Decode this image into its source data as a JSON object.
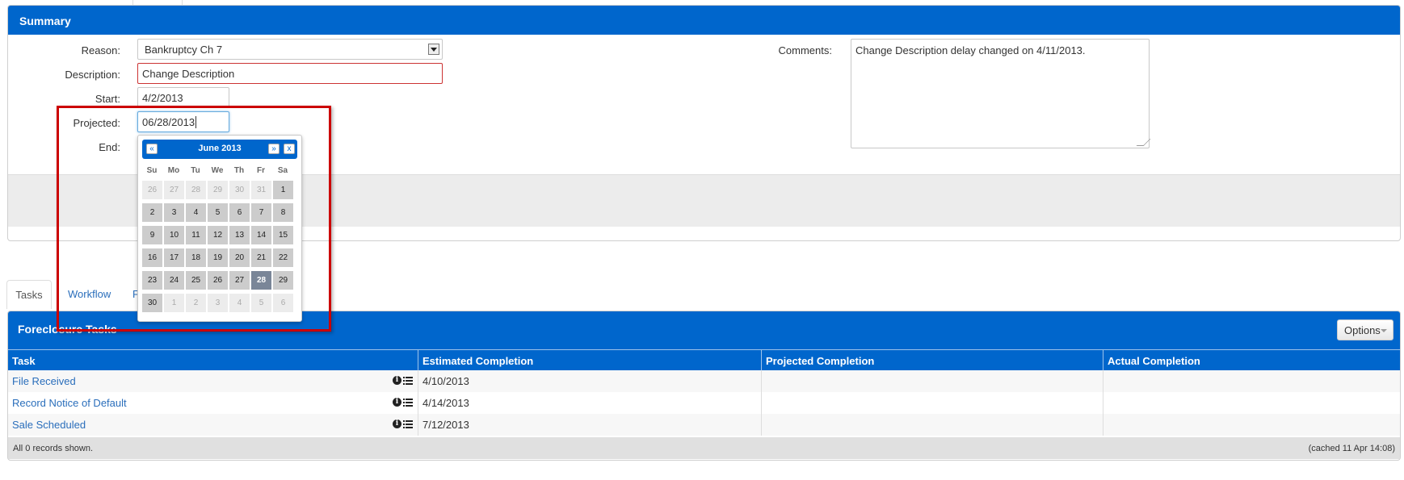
{
  "summary": {
    "title": "Summary",
    "reason_label": "Reason:",
    "reason_value": "Bankruptcy Ch 7",
    "description_label": "Description:",
    "description_value": "Change Description",
    "start_label": "Start:",
    "start_value": "4/2/2013",
    "projected_label": "Projected:",
    "projected_value": "06/28/2013",
    "end_label": "End:",
    "comments_label": "Comments:",
    "comments_value": "Change Description delay changed on 4/11/2013."
  },
  "datepicker": {
    "title": "June 2013",
    "prev": "«",
    "next": "»",
    "close": "x",
    "weekdays": [
      "Su",
      "Mo",
      "Tu",
      "We",
      "Th",
      "Fr",
      "Sa"
    ],
    "weeks": [
      [
        "26",
        "27",
        "28",
        "29",
        "30",
        "31",
        "1"
      ],
      [
        "2",
        "3",
        "4",
        "5",
        "6",
        "7",
        "8"
      ],
      [
        "9",
        "10",
        "11",
        "12",
        "13",
        "14",
        "15"
      ],
      [
        "16",
        "17",
        "18",
        "19",
        "20",
        "21",
        "22"
      ],
      [
        "23",
        "24",
        "25",
        "26",
        "27",
        "28",
        "29"
      ],
      [
        "30",
        "1",
        "2",
        "3",
        "4",
        "5",
        "6"
      ]
    ],
    "selected": "28"
  },
  "tabs": [
    "Tasks",
    "Workflow",
    "F"
  ],
  "tasks": {
    "title": "Foreclosure Tasks",
    "options_label": "Options",
    "columns": [
      "Task",
      "Estimated Completion",
      "Projected Completion",
      "Actual Completion"
    ],
    "rows": [
      {
        "task": "File Received",
        "estimated": "4/10/2013",
        "projected": "",
        "actual": ""
      },
      {
        "task": "Record Notice of Default",
        "estimated": "4/14/2013",
        "projected": "",
        "actual": ""
      },
      {
        "task": "Sale Scheduled",
        "estimated": "7/12/2013",
        "projected": "",
        "actual": ""
      }
    ],
    "footer_left": "All 0 records shown.",
    "footer_right": "(cached 11 Apr 14:08)"
  },
  "colors": {
    "header_blue": "#0066cc",
    "highlight_red": "#cc0000",
    "link_blue": "#2a6ebb"
  }
}
